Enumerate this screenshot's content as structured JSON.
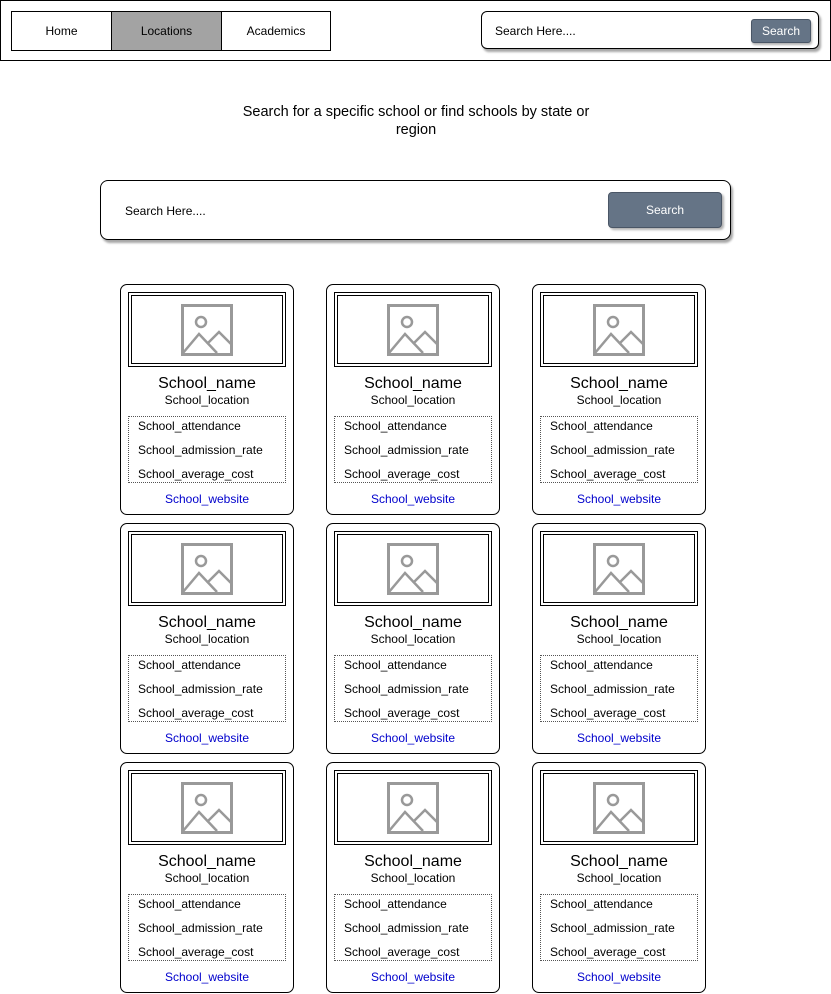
{
  "nav": {
    "tabs": [
      {
        "label": "Home"
      },
      {
        "label": "Locations",
        "active": true
      },
      {
        "label": "Academics"
      }
    ]
  },
  "header_search": {
    "placeholder": "Search Here....",
    "button_label": "Search"
  },
  "headline": "Search for a specific school or find schools by state or region",
  "main_search": {
    "placeholder": "Search Here....",
    "button_label": "Search"
  },
  "colors": {
    "button_bg": "#657486",
    "active_tab_bg": "#a3a3a3",
    "link": "#0000cc"
  },
  "cards": [
    {
      "name": "School_name",
      "location": "School_location",
      "attendance": "School_attendance",
      "admission_rate": "School_admission_rate",
      "average_cost": "School_average_cost",
      "website": "School_website",
      "image_icon": "image-placeholder-icon"
    },
    {
      "name": "School_name",
      "location": "School_location",
      "attendance": "School_attendance",
      "admission_rate": "School_admission_rate",
      "average_cost": "School_average_cost",
      "website": "School_website",
      "image_icon": "image-placeholder-icon"
    },
    {
      "name": "School_name",
      "location": "School_location",
      "attendance": "School_attendance",
      "admission_rate": "School_admission_rate",
      "average_cost": "School_average_cost",
      "website": "School_website",
      "image_icon": "image-placeholder-icon"
    },
    {
      "name": "School_name",
      "location": "School_location",
      "attendance": "School_attendance",
      "admission_rate": "School_admission_rate",
      "average_cost": "School_average_cost",
      "website": "School_website",
      "image_icon": "image-placeholder-icon"
    },
    {
      "name": "School_name",
      "location": "School_location",
      "attendance": "School_attendance",
      "admission_rate": "School_admission_rate",
      "average_cost": "School_average_cost",
      "website": "School_website",
      "image_icon": "image-placeholder-icon"
    },
    {
      "name": "School_name",
      "location": "School_location",
      "attendance": "School_attendance",
      "admission_rate": "School_admission_rate",
      "average_cost": "School_average_cost",
      "website": "School_website",
      "image_icon": "image-placeholder-icon"
    },
    {
      "name": "School_name",
      "location": "School_location",
      "attendance": "School_attendance",
      "admission_rate": "School_admission_rate",
      "average_cost": "School_average_cost",
      "website": "School_website",
      "image_icon": "image-placeholder-icon"
    },
    {
      "name": "School_name",
      "location": "School_location",
      "attendance": "School_attendance",
      "admission_rate": "School_admission_rate",
      "average_cost": "School_average_cost",
      "website": "School_website",
      "image_icon": "image-placeholder-icon"
    },
    {
      "name": "School_name",
      "location": "School_location",
      "attendance": "School_attendance",
      "admission_rate": "School_admission_rate",
      "average_cost": "School_average_cost",
      "website": "School_website",
      "image_icon": "image-placeholder-icon"
    }
  ]
}
